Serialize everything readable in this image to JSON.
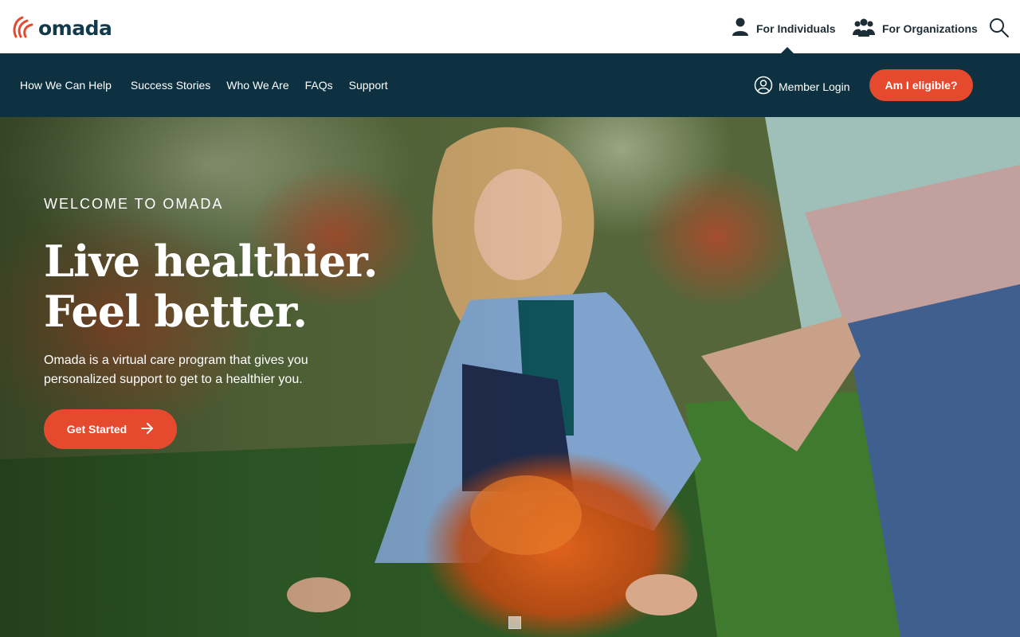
{
  "brand": {
    "name": "omada",
    "accent_color": "#e64a2e",
    "nav_color": "#0d3140"
  },
  "audience": {
    "individuals_label": "For Individuals",
    "organizations_label": "For Organizations"
  },
  "nav": {
    "links": [
      "How We Can Help",
      "Success Stories",
      "Who We Are",
      "FAQs",
      "Support"
    ],
    "member_login": "Member Login",
    "eligible_button": "Am I eligible?"
  },
  "hero": {
    "eyebrow": "WELCOME TO OMADA",
    "headline_line1": "Live healthier.",
    "headline_line2": "Feel better.",
    "subtext": "Omada is a virtual care program that gives you personalized support to get to a healthier you.",
    "cta_label": "Get Started"
  },
  "icons": {
    "logo": "omada-logo-icon",
    "individual": "person-icon",
    "organization": "group-icon",
    "search": "search-icon",
    "login": "user-circle-icon",
    "cta": "arrow-right-icon"
  }
}
